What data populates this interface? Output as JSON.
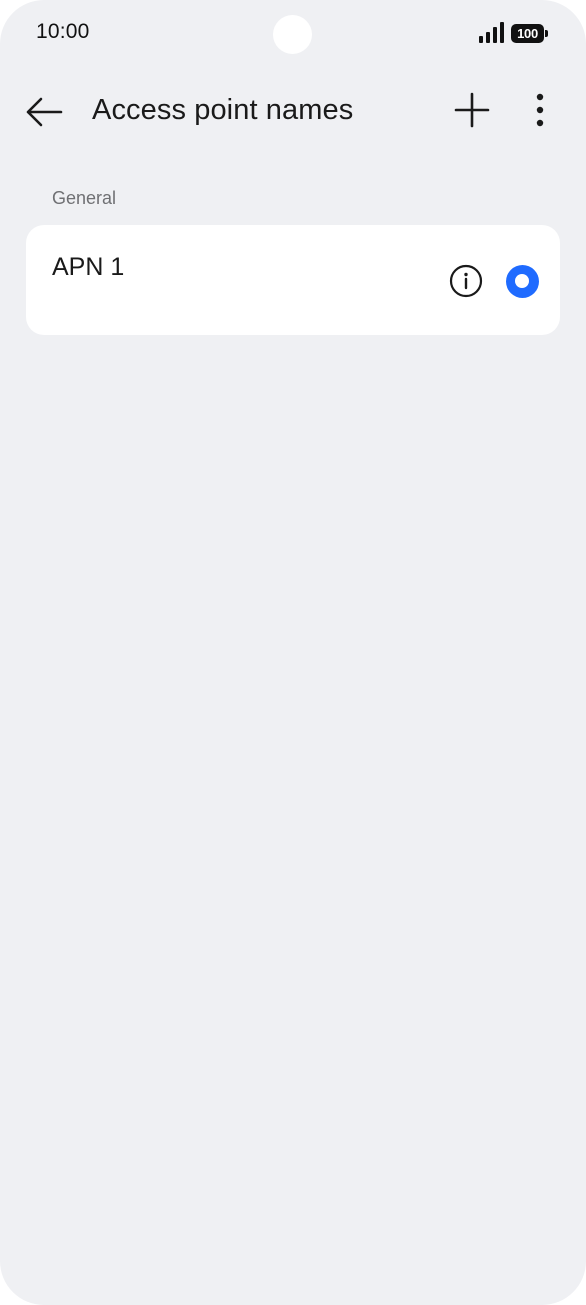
{
  "status_bar": {
    "time": "10:00",
    "battery_level": "100",
    "signal_icon": "cellular-signal-icon",
    "battery_icon": "battery-icon"
  },
  "app_bar": {
    "title": "Access point names",
    "back_icon": "arrow-left-icon",
    "add_icon": "plus-icon",
    "more_icon": "more-vertical-icon"
  },
  "sections": [
    {
      "header": "General",
      "items": [
        {
          "name": "APN 1",
          "info_icon": "info-icon",
          "selected": true
        }
      ]
    }
  ],
  "colors": {
    "background": "#eff0f3",
    "card": "#ffffff",
    "accent": "#1f6bff",
    "section_header": "#6f7073"
  }
}
